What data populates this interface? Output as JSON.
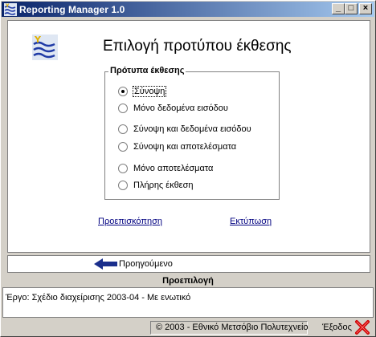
{
  "window": {
    "title": "Reporting Manager 1.0",
    "buttons": {
      "minimize": "_",
      "maximize": "□",
      "close": "×"
    }
  },
  "main": {
    "heading": "Επιλογή προτύπου έκθεσης",
    "group_label": "Πρότυπα έκθεσης",
    "options": [
      {
        "label": "Σύνοψη",
        "checked": true
      },
      {
        "label": "Μόνο δεδομένα εισόδου",
        "checked": false
      },
      {
        "label": "Σύνοψη και δεδομένα εισόδου",
        "checked": false
      },
      {
        "label": "Σύνοψη και αποτελέσματα",
        "checked": false
      },
      {
        "label": "Μόνο αποτελέσματα",
        "checked": false
      },
      {
        "label": "Πλήρης έκθεση",
        "checked": false
      }
    ],
    "preview_link": "Προεπισκόπηση",
    "print_link": "Εκτύπωση"
  },
  "nav": {
    "back_label": "Προηγούμενο"
  },
  "defaults": {
    "header": "Προεπιλογή",
    "text": "Έργο: Σχέδιο διαχείρισης 2003-04 - Με ενωτικό"
  },
  "status": {
    "copyright": "© 2003 - Εθνικό Μετσόβιο Πολυτεχνείο",
    "exit_label": "Έξοδος"
  },
  "colors": {
    "titlebar_start": "#0a246a",
    "titlebar_end": "#a6caf0",
    "link": "#000080",
    "arrow": "#1a2e8c",
    "exit_x": "#cc0000"
  },
  "icons": {
    "app": "water-waves-icon",
    "logo": "water-waves-logo-icon",
    "back": "arrow-left-icon",
    "exit": "red-x-icon"
  }
}
